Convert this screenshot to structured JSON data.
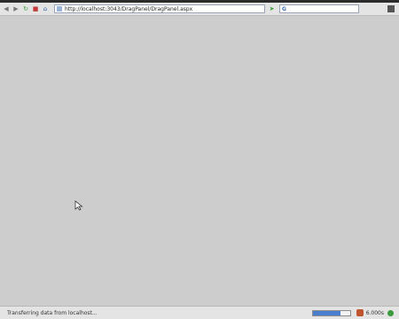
{
  "browser": {
    "address_url": "http://localhost:3043/DragPanel/DragPanel.aspx",
    "search_placeholder": "",
    "status_text": "Transferring data from localhost...",
    "load_progress": 0.75,
    "timer_text": "6.000s"
  },
  "icons": {
    "back": "back-arrow-icon",
    "forward": "forward-arrow-icon",
    "reload": "reload-icon",
    "stop": "stop-icon",
    "home": "home-icon",
    "go": "go-arrow-icon",
    "search_engine": "google-icon",
    "cursor": "mouse-pointer-icon"
  },
  "colors": {
    "content_background": "#cdcdcd",
    "progress_fill": "#4a7fd0"
  }
}
